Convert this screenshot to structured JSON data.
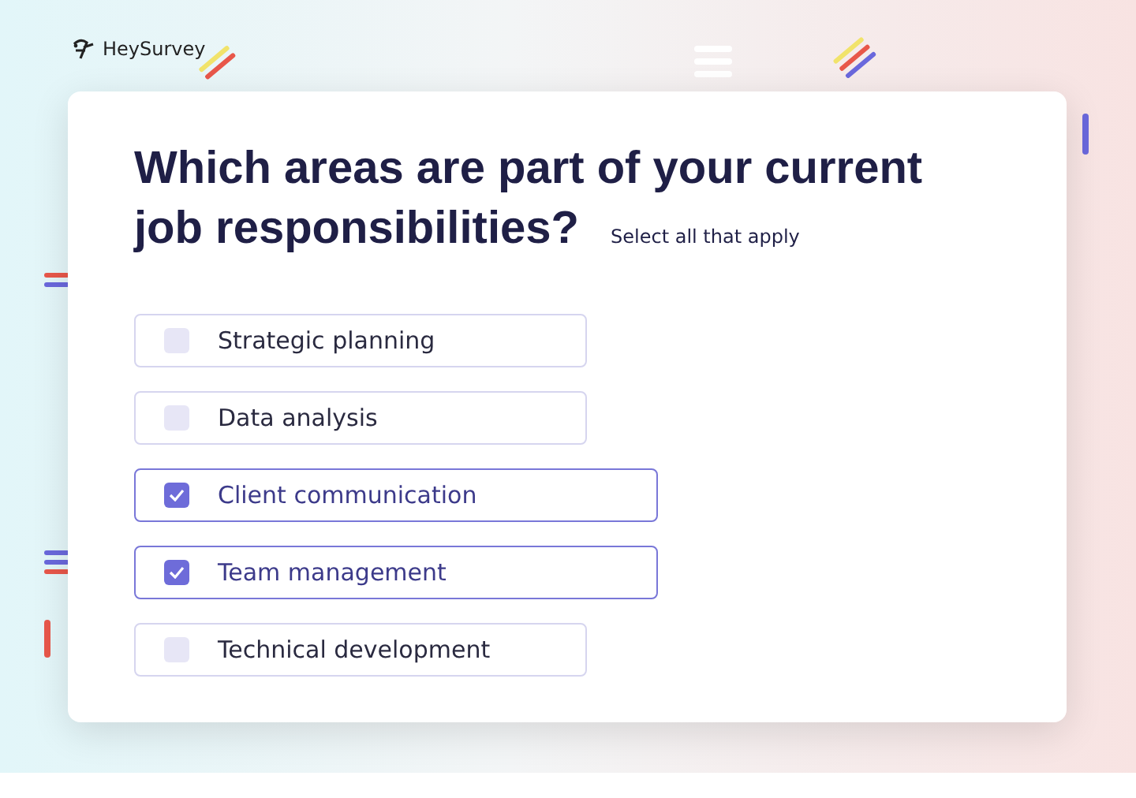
{
  "brand": {
    "name": "HeySurvey"
  },
  "question": {
    "title_lines": [
      "Which areas are part of your current",
      "job responsibilities?"
    ],
    "hint": "Select all that apply"
  },
  "options": [
    {
      "label": "Strategic planning",
      "checked": false
    },
    {
      "label": "Data analysis",
      "checked": false
    },
    {
      "label": "Client communication",
      "checked": true
    },
    {
      "label": "Team management",
      "checked": true
    },
    {
      "label": "Technical development",
      "checked": false
    }
  ]
}
